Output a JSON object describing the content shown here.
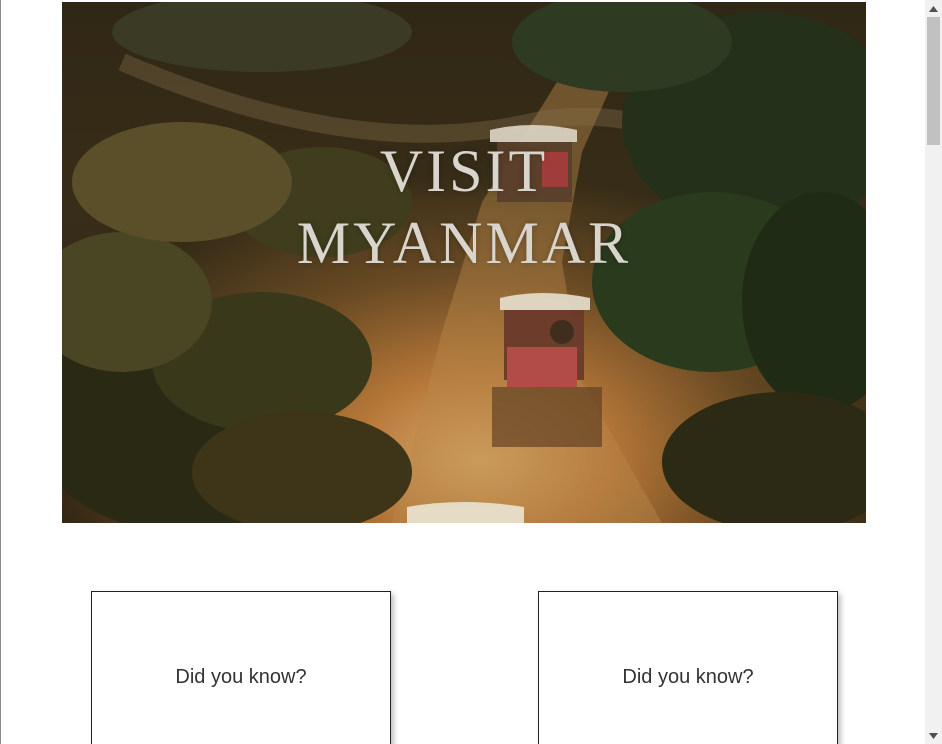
{
  "hero": {
    "title_line1": "VISIT",
    "title_line2": "MYANMAR",
    "image": "horse-carts-on-dusty-road-at-sunset"
  },
  "cards": [
    {
      "text": "Did you know?"
    },
    {
      "text": "Did you know?"
    }
  ],
  "colors": {
    "title_text": "#d9d4cc",
    "card_border": "#222222",
    "card_text": "#333333",
    "scrollbar_track": "#f1f1f1",
    "scrollbar_thumb": "#c1c1c1"
  }
}
